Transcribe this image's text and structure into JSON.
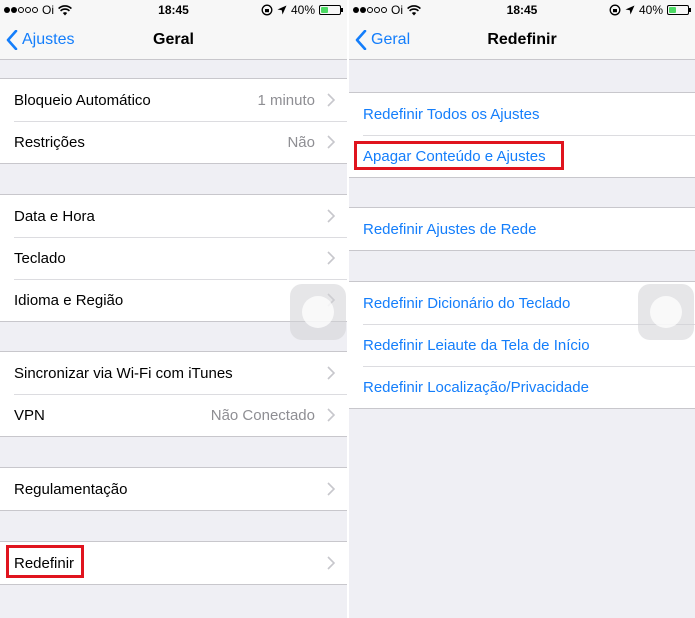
{
  "status": {
    "carrier": "Oi",
    "time": "18:45",
    "battery": "40%",
    "battery_level": 0.4
  },
  "left": {
    "nav": {
      "back_label": "Ajustes",
      "title": "Geral"
    },
    "groups": [
      {
        "rows": [
          {
            "label": "Bloqueio Automático",
            "value": "1 minuto"
          },
          {
            "label": "Restrições",
            "value": "Não"
          }
        ]
      },
      {
        "rows": [
          {
            "label": "Data e Hora",
            "value": ""
          },
          {
            "label": "Teclado",
            "value": ""
          },
          {
            "label": "Idioma e Região",
            "value": ""
          }
        ]
      },
      {
        "rows": [
          {
            "label": "Sincronizar via Wi-Fi com iTunes",
            "value": ""
          },
          {
            "label": "VPN",
            "value": "Não Conectado"
          }
        ]
      },
      {
        "rows": [
          {
            "label": "Regulamentação",
            "value": ""
          }
        ]
      },
      {
        "rows": [
          {
            "label": "Redefinir",
            "value": ""
          }
        ]
      }
    ]
  },
  "right": {
    "nav": {
      "back_label": "Geral",
      "title": "Redefinir"
    },
    "groups": [
      {
        "rows": [
          {
            "label": "Redefinir Todos os Ajustes"
          },
          {
            "label": "Apagar Conteúdo e Ajustes"
          }
        ]
      },
      {
        "rows": [
          {
            "label": "Redefinir Ajustes de Rede"
          }
        ]
      },
      {
        "rows": [
          {
            "label": "Redefinir Dicionário do Teclado"
          },
          {
            "label": "Redefinir Leiaute da Tela de Início"
          },
          {
            "label": "Redefinir Localização/Privacidade"
          }
        ]
      }
    ]
  },
  "colors": {
    "accent": "#147efb",
    "highlight": "#e0141e",
    "background": "#efeff4"
  },
  "icons": [
    "back-chevron-icon",
    "chevron-right-icon",
    "wifi-icon",
    "battery-icon",
    "location-icon",
    "lock-rotation-icon"
  ]
}
